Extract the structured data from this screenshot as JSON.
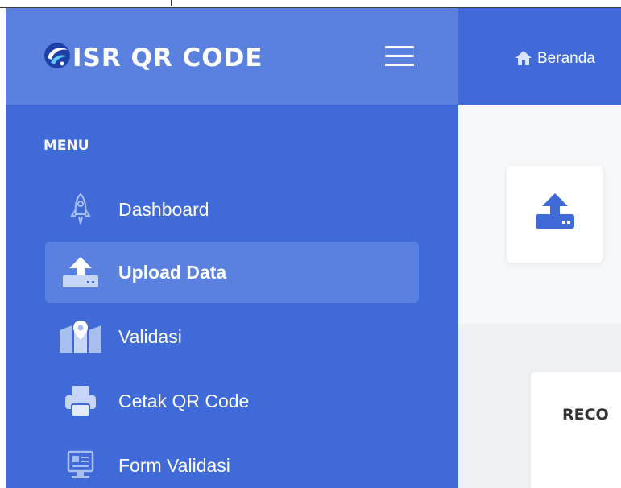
{
  "app": {
    "brand": "ISR QR CODE"
  },
  "sidebar": {
    "menu_title": "MENU",
    "items": [
      {
        "label": "Dashboard",
        "icon": "rocket-icon",
        "active": false
      },
      {
        "label": "Upload Data",
        "icon": "upload-icon",
        "active": true
      },
      {
        "label": "Validasi",
        "icon": "map-icon",
        "active": false
      },
      {
        "label": "Cetak QR Code",
        "icon": "printer-icon",
        "active": false
      },
      {
        "label": "Form Validasi",
        "icon": "monitor-icon",
        "active": false
      }
    ]
  },
  "topbar": {
    "breadcrumb": "Beranda"
  },
  "content": {
    "panel_title": "RECO"
  },
  "colors": {
    "sidebar": "#3f6ad8",
    "sidebar_header": "#5a81e0",
    "active_item": "#5a81e0",
    "icon_blue": "#3f6ad8"
  }
}
